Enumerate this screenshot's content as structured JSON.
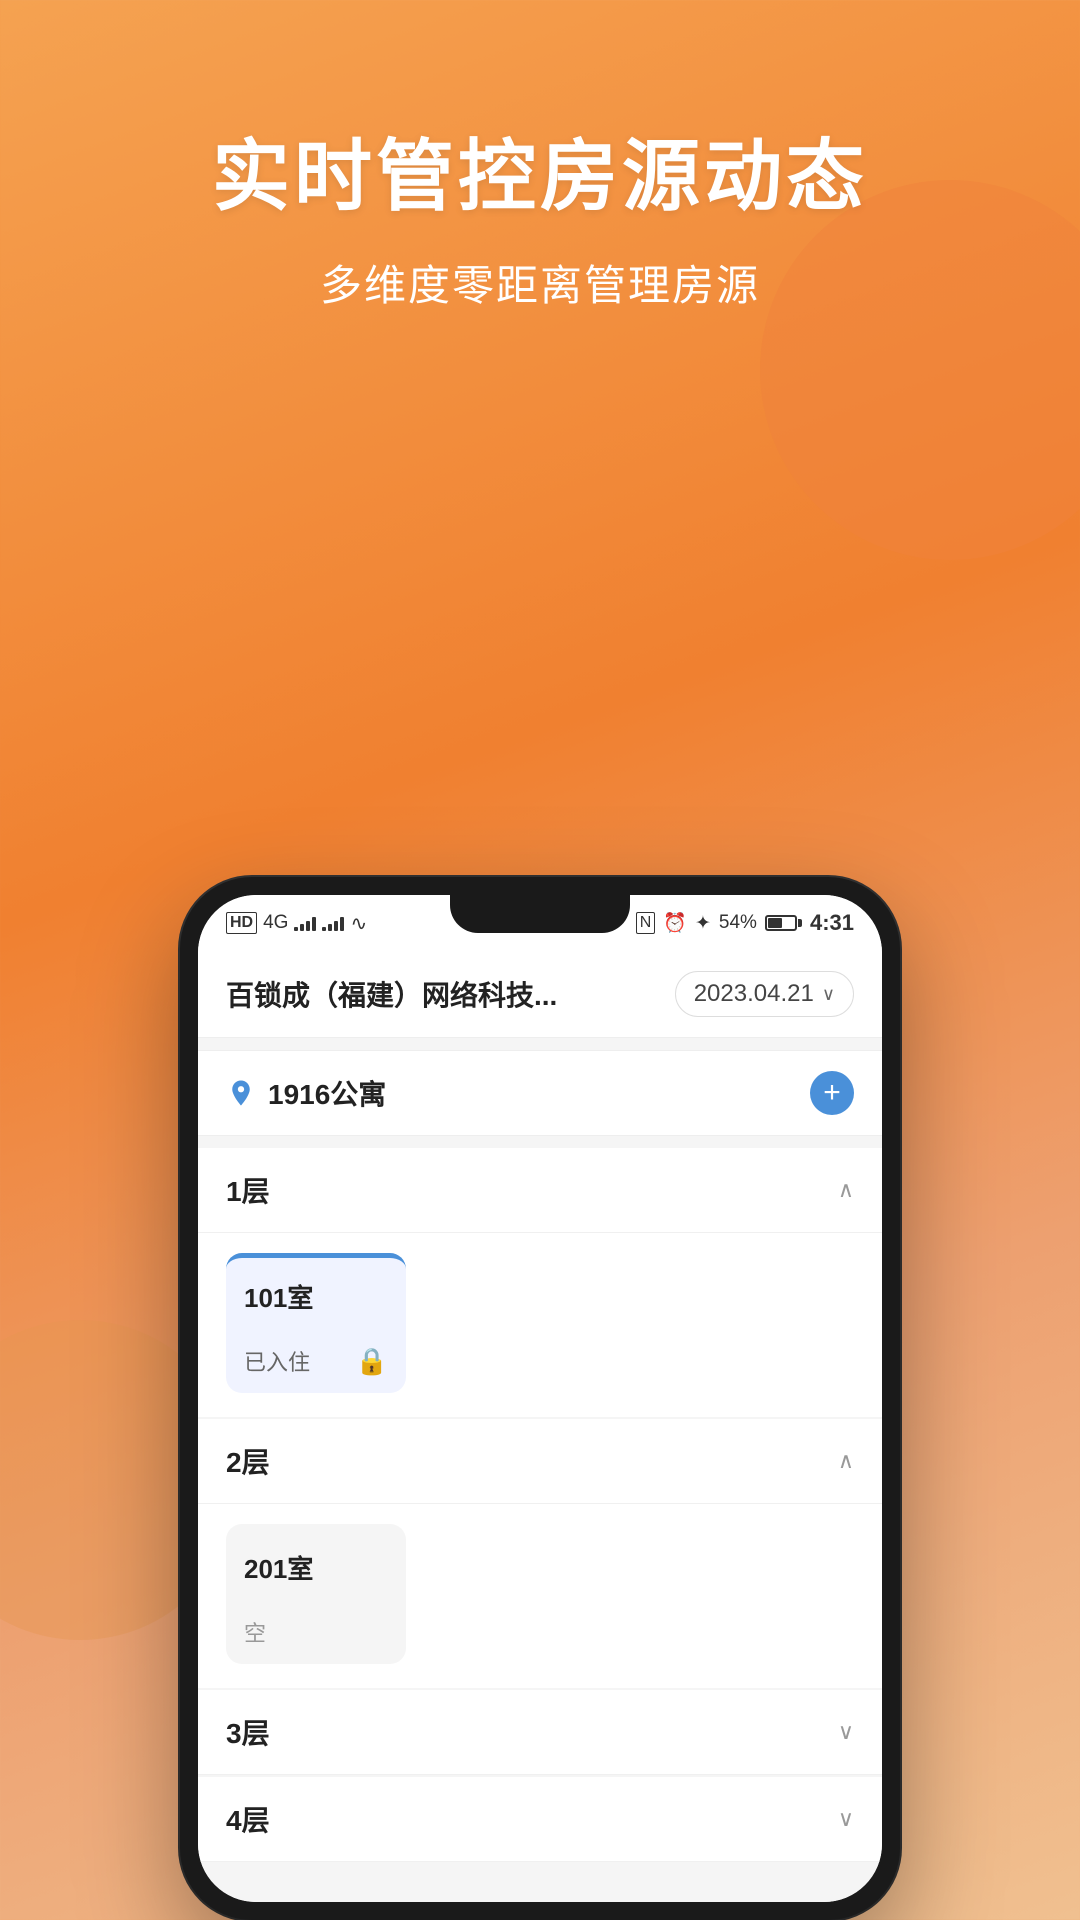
{
  "background": {
    "gradient_start": "#F5A251",
    "gradient_end": "#F0C090"
  },
  "hero": {
    "title": "实时管控房源动态",
    "subtitle": "多维度零距离管理房源"
  },
  "status_bar": {
    "network_type": "HD",
    "signal1": "4G",
    "signal2": "",
    "wifi": "WiFi",
    "nfc": "N",
    "bluetooth": "⌘",
    "battery_percent": "54%",
    "time": "4:31"
  },
  "app": {
    "header": {
      "company_name": "百锁成（福建）网络科技...",
      "date": "2023.04.21",
      "chevron": "∨"
    },
    "property": {
      "name": "1916公寓",
      "add_label": "+"
    },
    "floors": [
      {
        "label": "1层",
        "expanded": true,
        "chevron": "∧",
        "rooms": [
          {
            "number": "101室",
            "status": "已入住",
            "has_lock": true,
            "occupied": true
          }
        ]
      },
      {
        "label": "2层",
        "expanded": true,
        "chevron": "∧",
        "rooms": [
          {
            "number": "201室",
            "status": "空",
            "has_lock": false,
            "occupied": false
          }
        ]
      },
      {
        "label": "3层",
        "expanded": false,
        "chevron": "∨",
        "rooms": []
      },
      {
        "label": "4层",
        "expanded": false,
        "chevron": "∨",
        "rooms": []
      }
    ]
  }
}
